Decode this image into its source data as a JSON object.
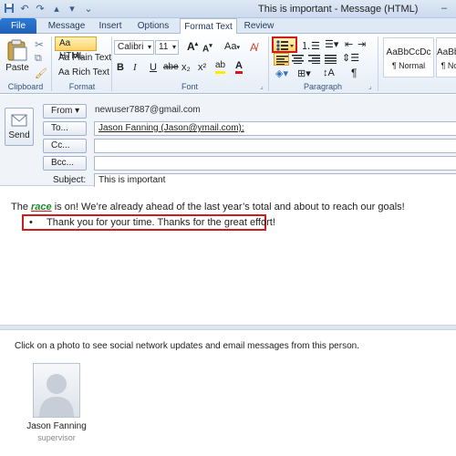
{
  "titlebar": {
    "title": "This is important  -  Message (HTML)",
    "qat_icons": [
      "save-icon",
      "undo-icon",
      "redo-icon",
      "up-arrow-icon",
      "down-arrow-icon",
      "qat-dropdown-icon"
    ],
    "window_buttons": [
      "–",
      "▭",
      "✕"
    ]
  },
  "tabs": {
    "file": "File",
    "message": "Message",
    "insert": "Insert",
    "options": "Options",
    "format_text": "Format Text",
    "review": "Review"
  },
  "clipboard": {
    "paste": "Paste",
    "label": "Clipboard"
  },
  "format": {
    "html": "HTML",
    "plain": "Plain Text",
    "rich": "Rich Text",
    "label": "Format"
  },
  "font": {
    "name": "Calibri",
    "size": "11",
    "label": "Font",
    "grow": "A",
    "shrink": "A",
    "change_case": "Aa",
    "bold": "B",
    "italic": "I",
    "underline": "U",
    "strike": "abe",
    "subscript": "x₂",
    "superscript": "x²",
    "highlight": "ab",
    "font_color": "A"
  },
  "paragraph": {
    "label": "Paragraph",
    "pilcrow": "¶"
  },
  "styles": {
    "normal_preview": "AaBbCcDc",
    "normal_name": "¶ Normal",
    "nospace_preview": "AaBbCc",
    "nospace_name": "¶ No"
  },
  "header": {
    "send": "Send",
    "from_btn": "From ▾",
    "from_value": "newuser7887@gmail.com",
    "to_btn": "To...",
    "to_value": "Jason Fanning (Jason@ymail.com);",
    "cc_btn": "Cc...",
    "cc_value": "",
    "bcc_btn": "Bcc...",
    "bcc_value": "",
    "subject_label": "Subject:",
    "subject_value": "This is important"
  },
  "body": {
    "line1_pre": "The ",
    "line1_word": "race",
    "line1_post": " is on! We’re already ahead of the last year’s total and about to reach our goals!",
    "bullet": "•",
    "bullet_text": "Thank you for your time. Thanks for the great effort!"
  },
  "people": {
    "hint": "Click on a photo to see social network updates and email messages from this person.",
    "name": "Jason Fanning",
    "role": "supervisor"
  },
  "colors": {
    "accent": "#1f5fb8",
    "highlight_red": "#d11a1a",
    "race_green": "#1a8a2e"
  }
}
